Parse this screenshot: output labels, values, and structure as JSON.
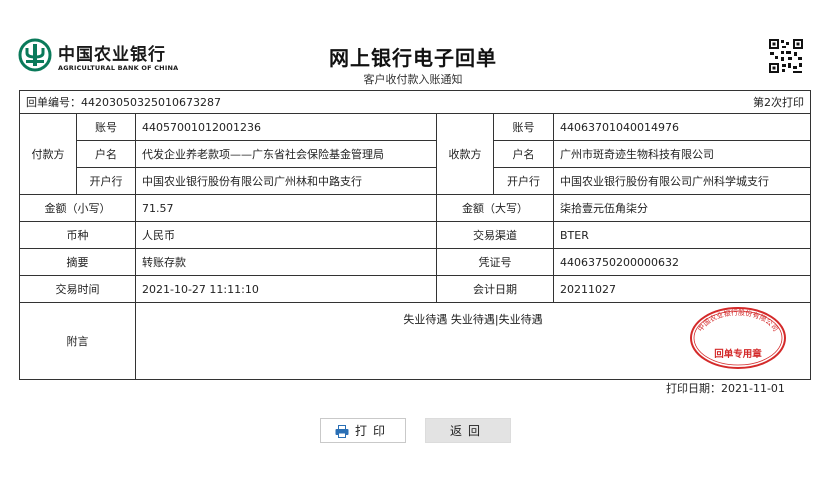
{
  "bank": {
    "name_cn": "中国农业银行",
    "name_en": "AGRICULTURAL BANK OF CHINA",
    "brand_color": "#0a7a5a"
  },
  "document": {
    "title": "网上银行电子回单",
    "subtitle": "客户收付款入账通知"
  },
  "receipt": {
    "number_label": "回单编号：",
    "number": "44203050325010673287",
    "print_count": "第2次打印",
    "payer": {
      "section_label": "付款方",
      "account_label": "账号",
      "account": "44057001012001236",
      "name_label": "户名",
      "name": "代发企业养老款项——广东省社会保险基金管理局",
      "bank_label": "开户行",
      "bank": "中国农业银行股份有限公司广州林和中路支行"
    },
    "payee": {
      "section_label": "收款方",
      "account_label": "账号",
      "account": "44063701040014976",
      "name_label": "户名",
      "name": "广州市斑奇迹生物科技有限公司",
      "bank_label": "开户行",
      "bank": "中国农业银行股份有限公司广州科学城支行"
    },
    "amount_small_label": "金额（小写）",
    "amount_small": "71.57",
    "amount_big_label": "金额（大写）",
    "amount_big": "柒拾壹元伍角柒分",
    "currency_label": "币种",
    "currency": "人民币",
    "channel_label": "交易渠道",
    "channel": "BTER",
    "summary_label": "摘要",
    "summary": "转账存款",
    "voucher_label": "凭证号",
    "voucher": "44063750200000632",
    "time_label": "交易时间",
    "time": "2021-10-27 11:11:10",
    "acct_date_label": "会计日期",
    "acct_date": "20211027",
    "note_label": "附言",
    "note": "失业待遇 失业待遇|失业待遇",
    "seal_ring_text": "中国农业银行股份有限公司",
    "seal_text": "回单专用章",
    "seal_color": "#d42a2a"
  },
  "print_date_label": "打印日期：",
  "print_date": "2021-11-01",
  "buttons": {
    "print": "打印",
    "back": "返回"
  },
  "icons": {
    "print": "printer-icon",
    "logo": "abc-logo-icon",
    "qr": "qr-code-icon"
  }
}
